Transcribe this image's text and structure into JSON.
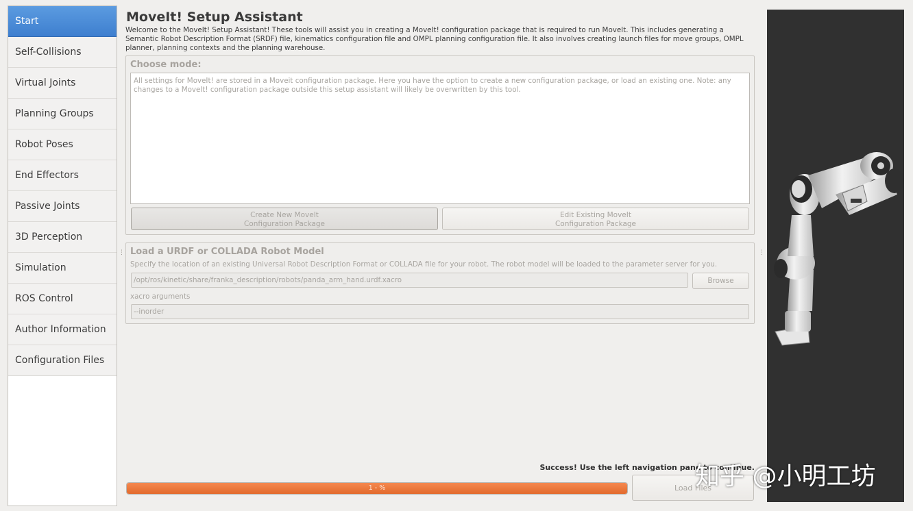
{
  "sidebar": {
    "items": [
      {
        "label": "Start",
        "active": true
      },
      {
        "label": "Self-Collisions"
      },
      {
        "label": "Virtual Joints"
      },
      {
        "label": "Planning Groups"
      },
      {
        "label": "Robot Poses"
      },
      {
        "label": "End Effectors"
      },
      {
        "label": "Passive Joints"
      },
      {
        "label": "3D Perception"
      },
      {
        "label": "Simulation"
      },
      {
        "label": "ROS Control"
      },
      {
        "label": "Author Information"
      },
      {
        "label": "Configuration Files"
      }
    ]
  },
  "main": {
    "title": "MoveIt! Setup Assistant",
    "intro": "Welcome to the MoveIt! Setup Assistant! These tools will assist you in creating a MoveIt! configuration package that is required to run MoveIt. This includes generating a Semantic Robot Description Format (SRDF) file, kinematics configuration file and OMPL planning configuration file. It also involves creating launch files for move groups, OMPL planner, planning contexts and the planning warehouse.",
    "mode": {
      "title": "Choose mode:",
      "description": "All settings for MoveIt! are stored in a Moveit configuration package. Here you have the option to create a new configuration package, or load an existing one. Note: any changes to a MoveIt! configuration package outside this setup assistant will likely be overwritten by this tool.",
      "create_label_1": "Create New MoveIt",
      "create_label_2": "Configuration Package",
      "edit_label_1": "Edit Existing MoveIt",
      "edit_label_2": "Configuration Package"
    },
    "urdf": {
      "title": "Load a URDF or COLLADA Robot Model",
      "description": "Specify the location of an existing Universal Robot Description Format or COLLADA file for your robot. The robot model will be loaded to the parameter server for you.",
      "path_value": "/opt/ros/kinetic/share/franka_description/robots/panda_arm_hand.urdf.xacro",
      "browse_label": "Browse",
      "xacro_label": "xacro arguments",
      "xacro_value": "--inorder"
    },
    "status_text": "Success! Use the left navigation pane to continue.",
    "progress": {
      "percent": 100,
      "text": "1 - %"
    },
    "load_label": "Load Files"
  },
  "watermark": "知乎 @小明工坊",
  "colors": {
    "active_nav": "#4a8bd8",
    "progress": "#e9763b",
    "viewer_bg": "#303030"
  }
}
